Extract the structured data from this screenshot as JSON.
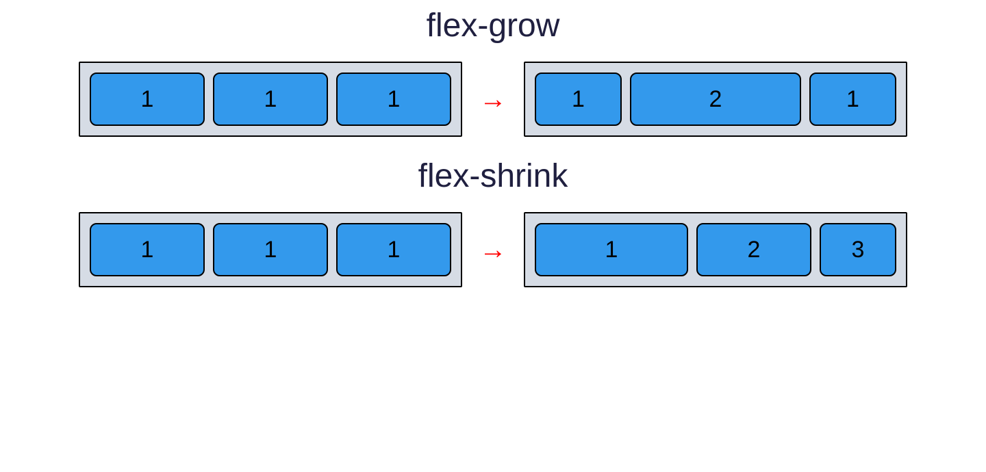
{
  "sections": [
    {
      "heading": "flex-grow",
      "left_boxes": [
        "1",
        "1",
        "1"
      ],
      "right_boxes": [
        "1",
        "2",
        "1"
      ],
      "arrow": "→"
    },
    {
      "heading": "flex-shrink",
      "left_boxes": [
        "1",
        "1",
        "1"
      ],
      "right_boxes": [
        "1",
        "2",
        "3"
      ],
      "arrow": "→"
    }
  ]
}
